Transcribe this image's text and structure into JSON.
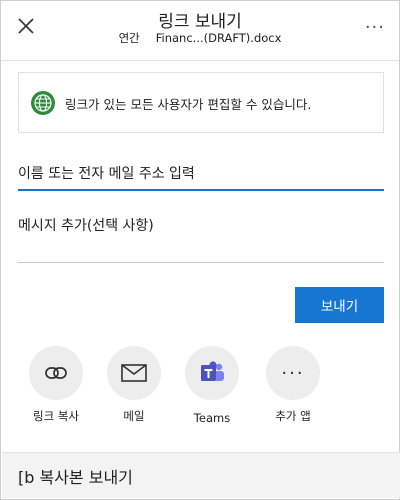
{
  "header": {
    "title": "링크 보내기",
    "sub_label": "연간",
    "file_name": "Financ...(DRAFT).docx",
    "close_icon": "close-icon",
    "more_icon": "more-icon",
    "more_glyph": "···"
  },
  "notice": {
    "icon": "globe-icon",
    "text": "링크가 있는 모든 사용자가 편집할 수 있습니다."
  },
  "form": {
    "to_placeholder": "이름 또는 전자 메일 주소 입력",
    "message_placeholder": "메시지 추가(선택 사항)",
    "send_label": "보내기"
  },
  "apps": [
    {
      "label": "링크 복사",
      "icon": "link-icon"
    },
    {
      "label": "메일",
      "icon": "mail-icon"
    },
    {
      "label": "Teams",
      "icon": "teams-icon"
    },
    {
      "label": "추가 앱",
      "icon": "more-apps-icon",
      "glyph": "···"
    }
  ],
  "footer": {
    "label": "[b 복사본 보내기"
  },
  "colors": {
    "accent": "#1776d1",
    "globe": "#2e8b3a",
    "teams": "#4b53bc"
  }
}
